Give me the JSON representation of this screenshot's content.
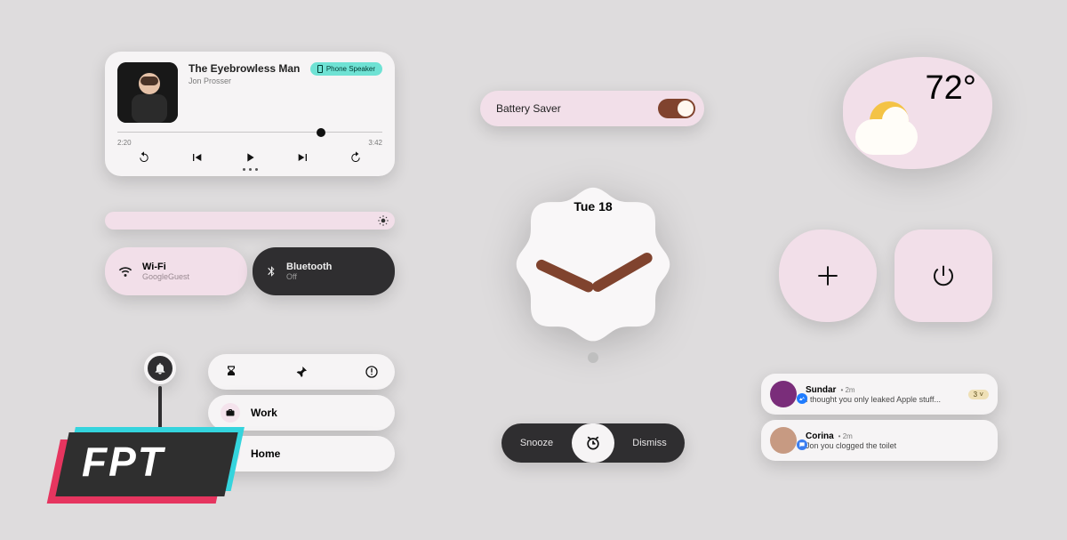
{
  "player": {
    "title": "The Eyebrowless Man",
    "artist": "Jon Prosser",
    "device_label": "Phone Speaker",
    "elapsed": "2:20",
    "duration": "3:42",
    "progress_pct": 75
  },
  "tiles": {
    "wifi": {
      "label": "Wi-Fi",
      "sub": "GoogleGuest"
    },
    "bluetooth": {
      "label": "Bluetooth",
      "sub": "Off"
    }
  },
  "places": [
    {
      "label": "Work",
      "icon": "briefcase-icon"
    },
    {
      "label": "Home",
      "icon": "home-icon"
    }
  ],
  "battery_saver": {
    "label": "Battery Saver",
    "on": true
  },
  "clock": {
    "date": "Tue 18"
  },
  "alarm": {
    "snooze": "Snooze",
    "dismiss": "Dismiss"
  },
  "weather": {
    "temp": "72°",
    "condition": "partly-cloudy"
  },
  "notifications": [
    {
      "sender": "Sundar",
      "time": "2m",
      "body": "I thought you only leaked Apple stuff...",
      "count": "3",
      "app": "messenger",
      "avatar_color": "#7a2d7a"
    },
    {
      "sender": "Corina",
      "time": "2m",
      "body": "Jon you clogged the toilet",
      "count": "",
      "app": "messages",
      "avatar_color": "#c79a82"
    }
  ],
  "watermark": "FPT"
}
